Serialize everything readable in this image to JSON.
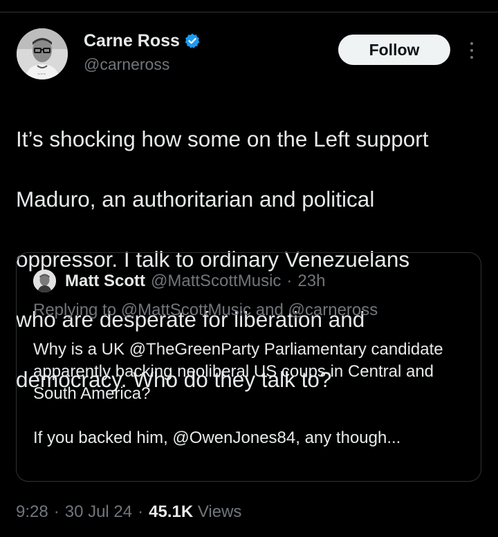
{
  "tweet": {
    "author": {
      "name": "Carne Ross",
      "handle": "@carneross",
      "verified": true,
      "verified_color": "#1d9bf0"
    },
    "follow_label": "Follow",
    "more_icon": "more-vertical-icon",
    "lines": [
      "It’s shocking how some on the Left support",
      "Maduro, an authoritarian and political",
      "oppressor.  I talk to ordinary Venezuelans",
      "who are desperate for liberation and",
      "democracy.  Who do they talk to?"
    ],
    "quote": {
      "name": "Matt Scott",
      "handle": "@MattScottMusic",
      "separator": "·",
      "time": "23h",
      "replying": "Replying to @MattScottMusic and @carneross",
      "paragraph1": "Why is a UK @TheGreenParty Parliamentary candidate apparently backing neoliberal US coups in Central and South America?",
      "paragraph2": "If you backed him, @OwenJones84, any though..."
    },
    "meta": {
      "time": "9:28",
      "sep1": "·",
      "date": "30 Jul 24",
      "sep2": "·",
      "views_count": "45.1K",
      "views_label": "Views"
    }
  },
  "colors": {
    "background": "#000000",
    "primary_text": "#e7e9ea",
    "secondary_text": "#71767b",
    "border": "#2f3336",
    "follow_bg": "#eff3f4"
  }
}
